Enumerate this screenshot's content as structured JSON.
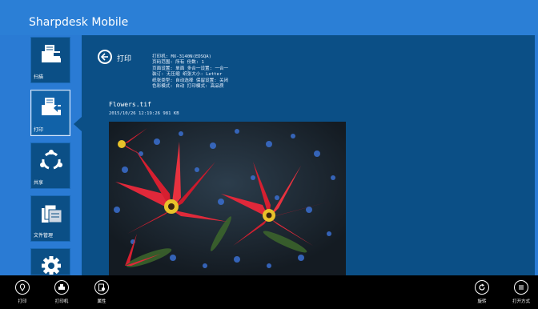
{
  "app": {
    "title": "Sharpdesk Mobile"
  },
  "sidebar": {
    "items": [
      {
        "label": "扫描",
        "icon": "scan-icon"
      },
      {
        "label": "打印",
        "icon": "print-icon"
      },
      {
        "label": "共享",
        "icon": "share-icon"
      },
      {
        "label": "文件管理",
        "icon": "file-management-icon"
      },
      {
        "label": "",
        "icon": "settings-icon"
      }
    ],
    "active_index": 1
  },
  "print_panel": {
    "title": "打印",
    "settings": [
      "打印机: MX-3140N(EDSQA)",
      "页码范围: 所有  份数: 1",
      "页面设置: 单面  多合一设置: 一合一",
      "装订: 无压缩  纸张大小: Letter",
      "纸张类型: 自动选择  保留设置: 关闭",
      "色彩模式: 自动  打印模式: 高品质"
    ],
    "file": {
      "name": "Flowers.tif",
      "info": "2015/10/26 12:19:26 981 KB"
    }
  },
  "bottom_bar": {
    "left": [
      {
        "label": "打印",
        "icon": "print-icon"
      },
      {
        "label": "打印机",
        "icon": "printer-icon"
      },
      {
        "label": "属性",
        "icon": "properties-icon"
      }
    ],
    "right": [
      {
        "label": "旋转",
        "icon": "rotate-icon"
      },
      {
        "label": "打开方式",
        "icon": "open-with-icon"
      }
    ]
  },
  "colors": {
    "accent": "#2b7fd6",
    "panel": "#0b4f86",
    "bottom_bar": "#000000"
  }
}
